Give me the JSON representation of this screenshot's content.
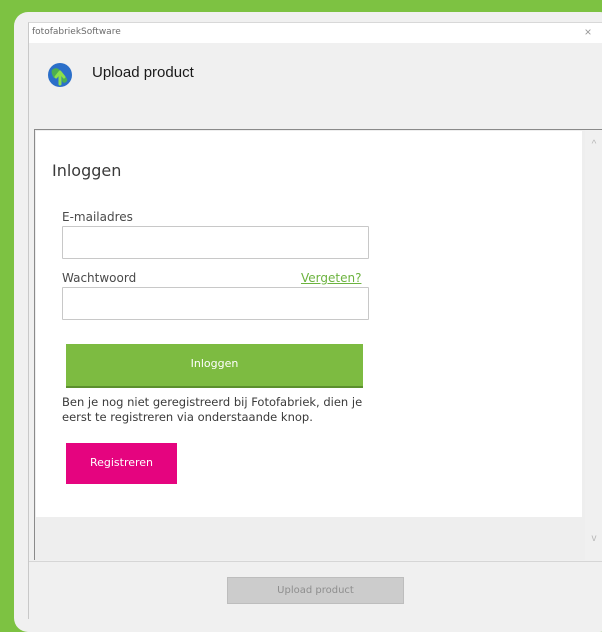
{
  "window": {
    "title": "fotofabriekSoftware",
    "close_glyph": "×"
  },
  "header": {
    "icon": "globe-upload-icon",
    "title": "Upload product"
  },
  "login_form": {
    "title": "Inloggen",
    "email_label": "E-mailadres",
    "email_value": "",
    "password_label": "Wachtwoord",
    "password_value": "",
    "forgot_link": "Vergeten?",
    "login_button": "Inloggen",
    "info_text": "Ben je nog niet geregistreerd bij Fotofabriek, dien je eerst te registreren via onderstaande knop.",
    "register_button": "Registreren"
  },
  "scrollbar": {
    "up_glyph": "^",
    "down_glyph": "v"
  },
  "footer": {
    "upload_button": "Upload product"
  },
  "colors": {
    "background": "#7dc242",
    "login_button": "#7dbb41",
    "register_button": "#e5047f",
    "link": "#6cb33f"
  }
}
